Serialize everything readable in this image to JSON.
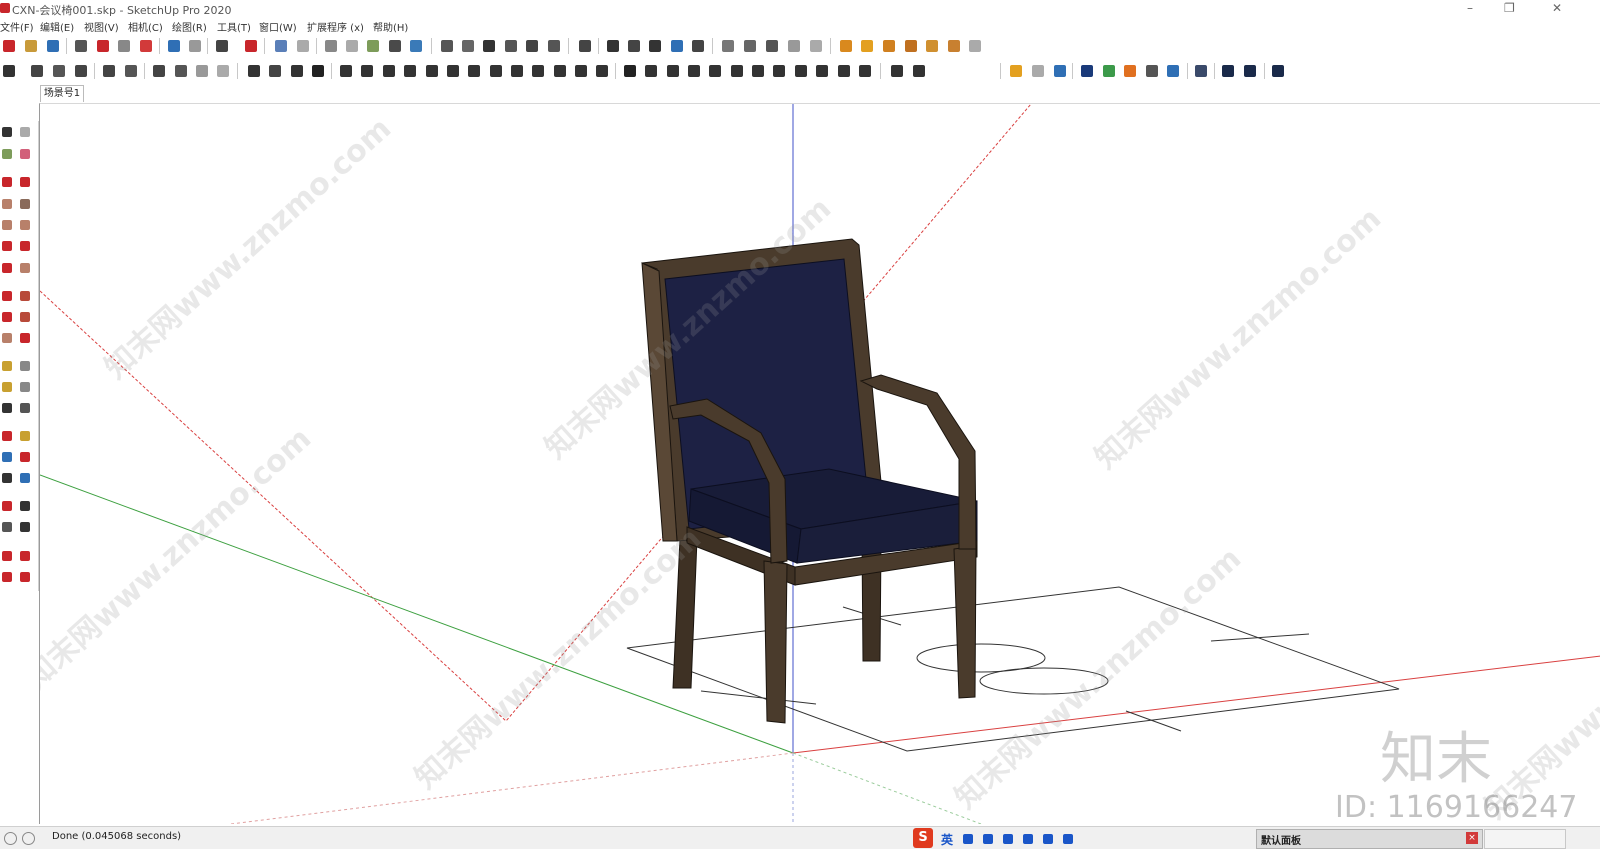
{
  "window": {
    "title": "CXN-会议椅001.skp - SketchUp Pro 2020",
    "min": "–",
    "max": "❐",
    "close": "✕"
  },
  "menus": [
    "文件(F)",
    "编辑(E)",
    "视图(V)",
    "相机(C)",
    "绘图(R)",
    "工具(T)",
    "窗口(W)",
    "扩展程序 (x)",
    "帮助(H)"
  ],
  "scene_tab": "场景号1",
  "status": {
    "text": "Done (0.045068 seconds)"
  },
  "ime": {
    "logo": "S",
    "label": "英"
  },
  "tray_panel": {
    "label": "默认面板",
    "close": "×"
  },
  "watermark": {
    "site": "知末网www.znzmo.com",
    "brand": "知末",
    "id": "ID: 1169166247"
  },
  "colors": {
    "chair_fabric": "#1d2144",
    "chair_wood": "#4a3b2c",
    "axis_red": "#d94040",
    "axis_green": "#3da040",
    "axis_blue": "#4050c8"
  }
}
